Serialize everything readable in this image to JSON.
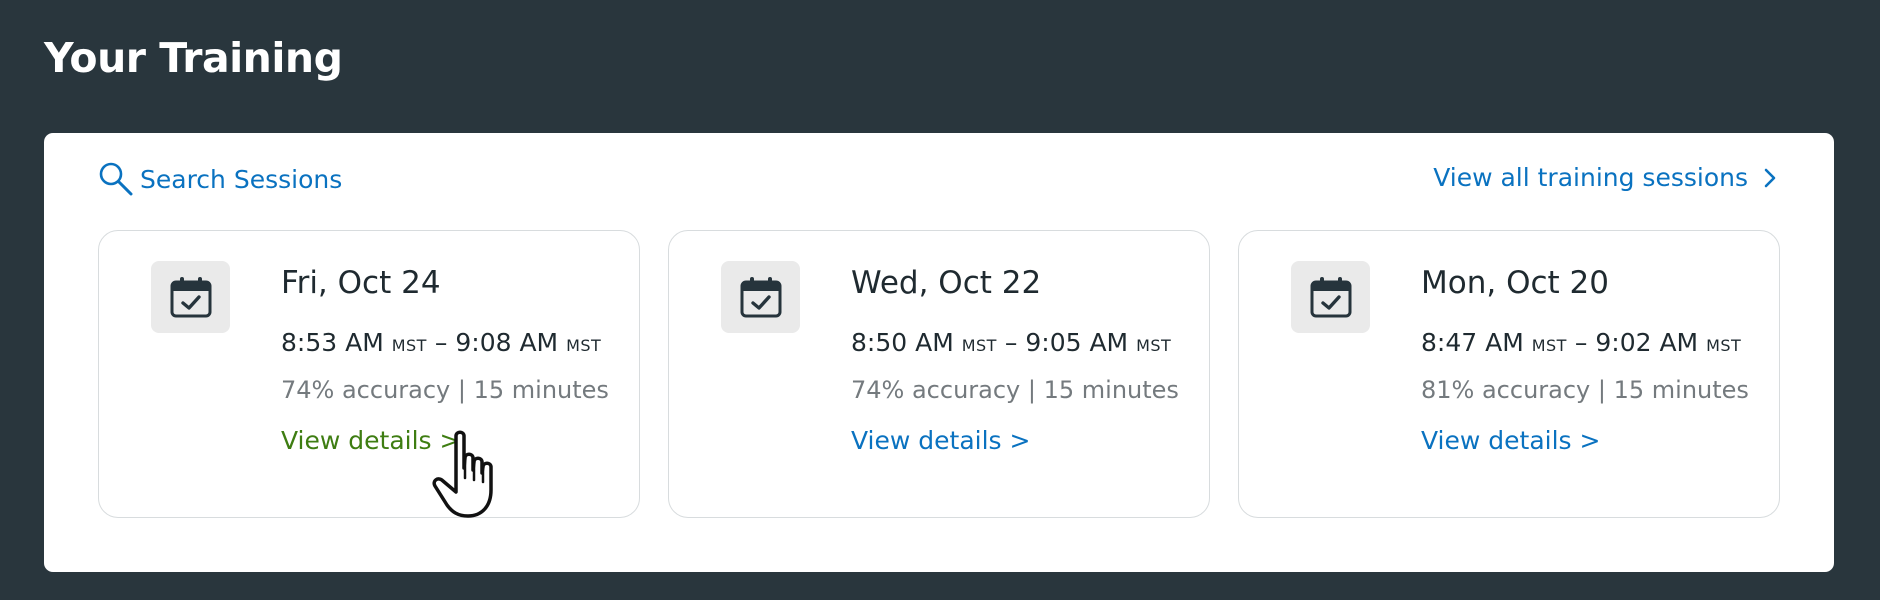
{
  "header": {
    "title": "Your Training"
  },
  "toolbar": {
    "search_label": "Search Sessions",
    "view_all_label": "View all training sessions"
  },
  "sessions": [
    {
      "date": "Fri, Oct 24",
      "start": "8:53 AM",
      "start_tz": "MST",
      "end": "9:08 AM",
      "end_tz": "MST",
      "dash": "–",
      "stats": "74% accuracy | 15 minutes",
      "link": "View details >"
    },
    {
      "date": "Wed, Oct 22",
      "start": "8:50 AM",
      "start_tz": "MST",
      "end": "9:05 AM",
      "end_tz": "MST",
      "dash": "–",
      "stats": "74% accuracy | 15 minutes",
      "link": "View details >"
    },
    {
      "date": "Mon, Oct 20",
      "start": "8:47 AM",
      "start_tz": "MST",
      "end": "9:02 AM",
      "end_tz": "MST",
      "dash": "–",
      "stats": "81% accuracy | 15 minutes",
      "link": "View details >"
    }
  ],
  "colors": {
    "background": "#29363d",
    "link": "#0a72c0",
    "link_hover": "#3e7d12",
    "text": "#1f2a30",
    "muted": "#747a7e"
  },
  "icons": {
    "search": "search-icon",
    "chevron": "chevron-right-icon",
    "calendar": "calendar-check-icon",
    "cursor": "hand-pointer-cursor-icon"
  }
}
